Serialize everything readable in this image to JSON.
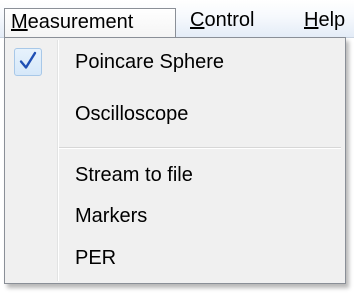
{
  "menubar": {
    "measurement": {
      "accel": "M",
      "rest": "easurement"
    },
    "control": {
      "accel": "C",
      "rest": "ontrol"
    },
    "help": {
      "accel": "H",
      "rest": "elp"
    }
  },
  "dropdown": {
    "items": [
      {
        "label": "Poincare Sphere",
        "checked": true,
        "check_icon": "checkmark-icon"
      },
      {
        "label": "Oscilloscope",
        "checked": false
      },
      {
        "label": "Stream to file",
        "checked": false
      },
      {
        "label": "Markers",
        "checked": false
      },
      {
        "label": "PER",
        "checked": false
      }
    ]
  },
  "colors": {
    "check": "#1f4fb4",
    "menubar_gradient_bottom": "#e4ecf7",
    "dropdown_bg": "#f0f0f0"
  }
}
